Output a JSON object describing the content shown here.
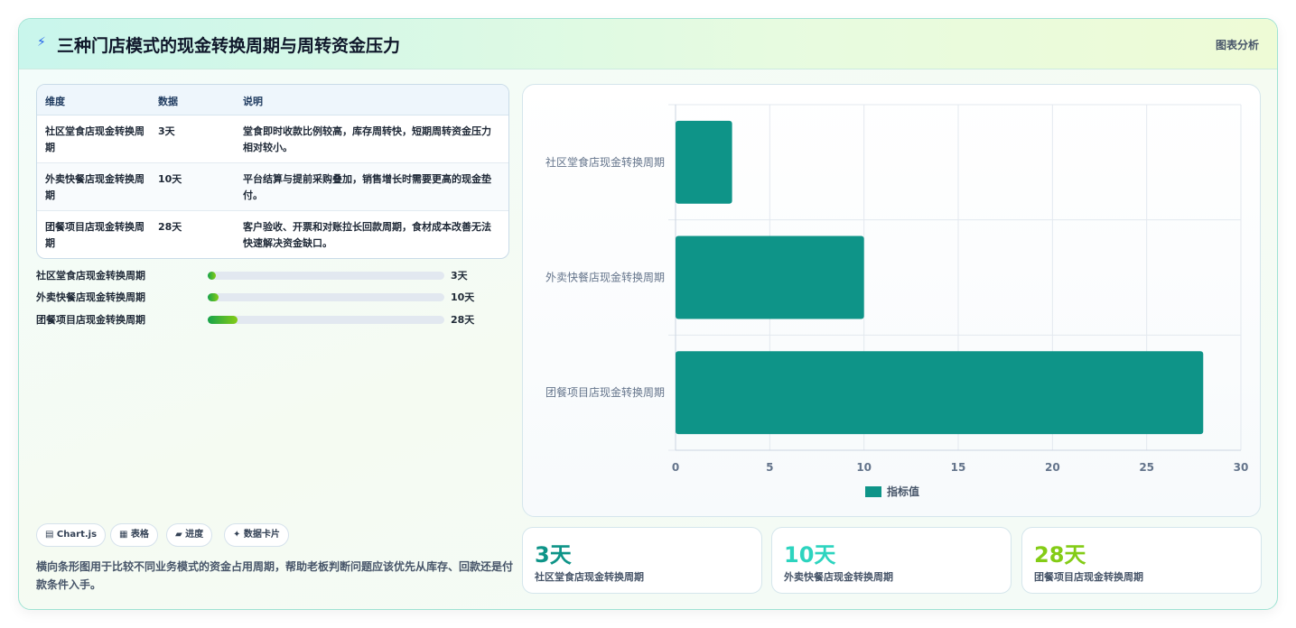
{
  "header": {
    "title": "三种门店模式的现金转换周期与周转资金压力",
    "tag": "图表分析",
    "icon": "bolt-icon"
  },
  "table": {
    "headers": [
      "维度",
      "数据",
      "说明"
    ],
    "rows": [
      {
        "dim": "社区堂食店现金转换周期",
        "data": "3天",
        "desc": "堂食即时收款比例较高，库存周转快，短期周转资金压力相对较小。"
      },
      {
        "dim": "外卖快餐店现金转换周期",
        "data": "10天",
        "desc": "平台结算与提前采购叠加，销售增长时需要更高的现金垫付。"
      },
      {
        "dim": "团餐项目店现金转换周期",
        "data": "28天",
        "desc": "客户验收、开票和对账拉长回款周期，食材成本改善无法快速解决资金缺口。"
      }
    ]
  },
  "progress": [
    {
      "label": "社区堂食店现金转换周期",
      "value": "3天",
      "fraction": 0.035
    },
    {
      "label": "外卖快餐店现金转换周期",
      "value": "10天",
      "fraction": 0.045
    },
    {
      "label": "团餐项目店现金转换周期",
      "value": "28天",
      "fraction": 0.125
    }
  ],
  "chips": [
    "▤ Chart.js",
    "▦ 表格",
    "▰ 进度",
    "✦ 数据卡片"
  ],
  "note": "横向条形图用于比较不同业务模式的资金占用周期，帮助老板判断问题应该优先从库存、回款还是付款条件入手。",
  "chart_data": {
    "type": "bar",
    "orientation": "horizontal",
    "categories": [
      "社区堂食店现金转换周期",
      "外卖快餐店现金转换周期",
      "团餐项目店现金转换周期"
    ],
    "series": [
      {
        "name": "指标值",
        "values": [
          3,
          10,
          28
        ],
        "color": "#0e9488"
      }
    ],
    "xlim": [
      0,
      30
    ],
    "xticks": [
      0,
      5,
      10,
      15,
      20,
      25,
      30
    ],
    "grid": true,
    "legend": "bottom"
  },
  "kpis": [
    {
      "value": "3天",
      "label": "社区堂食店现金转换周期",
      "color": "#0e9488"
    },
    {
      "value": "10天",
      "label": "外卖快餐店现金转换周期",
      "color": "#2dd4bf"
    },
    {
      "value": "28天",
      "label": "团餐项目店现金转换周期",
      "color": "#84cc16"
    }
  ]
}
